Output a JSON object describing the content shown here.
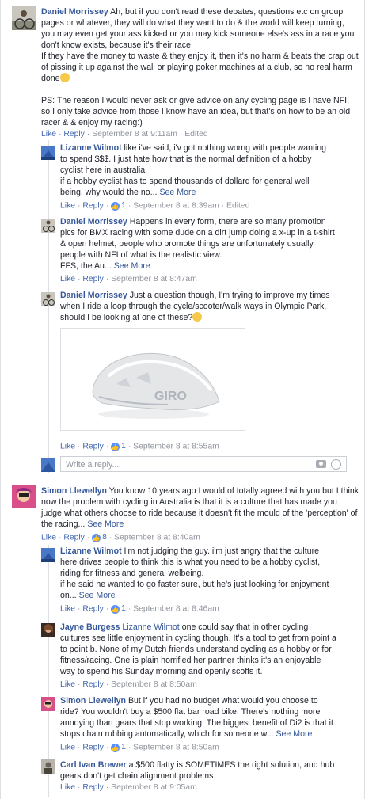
{
  "actions": {
    "like": "Like",
    "reply": "Reply",
    "see_more": "See More",
    "write_reply": "Write a reply...",
    "dot": "·"
  },
  "c1": {
    "author": "Daniel Morrissey",
    "text": " Ah, but if you don't read these debates, questions etc on group pages or whatever, they will do what they want to do & the world will keep turning, you may even get your ass kicked or you may kick someone else's ass in a race you don't know exists, because it's their race.\nIf they have the money to waste & they enjoy it, then it's no harm & beats the crap out of pissing it up against the wall or playing poker machines at a club, so no real harm done",
    "text2": "PS: The reason I would never ask or give advice on any cycling page is I have NFI, so I only take advice from those I know have an idea, but that's on how to be an old racer & & enjoy my racing:)",
    "time": "September 8 at 9:11am",
    "edited": "Edited"
  },
  "r1": {
    "author": "Lizanne Wilmot",
    "text": " like i've said, i'v got nothing worng with people wanting to spend $$$. I just hate how that is the normal definition of a hobby cyclist here in australia.\nif a hobby cyclist has to spend thousands of dollard for general well being, why would the no...",
    "likes": "1",
    "time": "September 8 at 8:39am",
    "edited": "Edited"
  },
  "r2": {
    "author": "Daniel Morrissey",
    "text": " Happens in every form, there are so many promotion pics for BMX racing with some dude on a dirt jump doing a x-up in a t-shirt & open helmet, people who promote things are unfortunately usually people with NFI of what is the realistic view.\nFFS, the Au...",
    "time": "September 8 at 8:47am"
  },
  "r3": {
    "author": "Daniel Morrissey",
    "text": " Just a question though, I'm trying to improve my times when I ride a loop through the cycle/scooter/walk ways in Olympic Park, should I be looking at one of these?",
    "image_brand": "GIRO",
    "likes": "1",
    "time": "September 8 at 8:55am"
  },
  "c2": {
    "author": "Simon Llewellyn",
    "text": " You know 10 years ago I would of totally agreed with you but I think now the problem with cycling in Australia is that it is a culture that has made you judge what others choose to ride because it doesn't fit the mould of the 'perception' of the racing...",
    "likes": "8",
    "time": "September 8 at 8:40am"
  },
  "r4": {
    "author": "Lizanne Wilmot",
    "text": " I'm not judging the guy. i'm just angry that the culture here drives people to think this is what you need to be a hobby cyclist, riding for fitness and general welbeing.\nif he said he wanted to go faster sure, but he's just looking for enjoyment on...",
    "likes": "1",
    "time": "September 8 at 8:46am"
  },
  "r5": {
    "author": "Jayne Burgess",
    "mention": "Lizanne Wilmot",
    "text": " one could say that in other cycling cultures see little enjoyment in cycling though. It's a tool to get from point a to point b. None of my Dutch friends understand cycling as a hobby or for fitness/racing. One is plain horrified her partner thinks it's an enjoyable way to spend his Sunday morning and openly scoffs it.",
    "time": "September 8 at 8:50am"
  },
  "r6": {
    "author": "Simon Llewellyn",
    "text": " But if you had no budget what would you choose to ride? You wouldn't buy a $500 flat bar road bike. There's nothing more annoying than gears that stop working. The biggest benefit of Di2 is that it stops chain rubbing automatically, which for someone w...",
    "likes": "1",
    "time": "September 8 at 8:50am"
  },
  "r7": {
    "author": "Carl Ivan Brewer",
    "text": " a $500 flatty is SOMETIMES the right solution, and hub gears don't get chain alignment problems.",
    "time": "September 8 at 9:05am"
  },
  "colors": {
    "link": "#365899",
    "action": "#4267b2",
    "meta": "#90949c"
  }
}
